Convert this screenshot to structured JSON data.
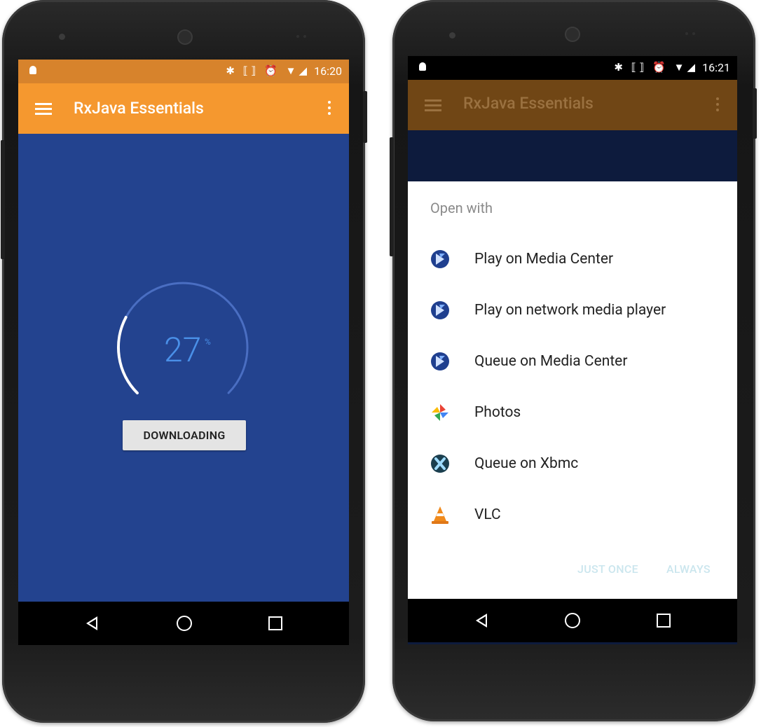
{
  "left_phone": {
    "status_time": "16:20",
    "status_icons": "✱ ⟦⟧ ⏰ ▼◢",
    "app_title": "RxJava Essentials",
    "progress_value": "27",
    "progress_unit": "%",
    "progress_fraction": 0.27,
    "download_button": "DOWNLOADING",
    "colors": {
      "status": "#d7832c",
      "appbar": "#f5982f",
      "content": "#23438f",
      "arc": "#ffffff",
      "track": "#4a6ec2",
      "number": "#4a90e8"
    }
  },
  "right_phone": {
    "status_time": "16:21",
    "status_icons": "✱ ⟦⟧ ⏰ ▼◢",
    "app_title": "RxJava Essentials",
    "dialog": {
      "title": "Open with",
      "options": [
        {
          "label": "Play on Media Center",
          "icon": "kodi-icon"
        },
        {
          "label": "Play on network media player",
          "icon": "kodi-icon"
        },
        {
          "label": "Queue on Media Center",
          "icon": "kodi-icon"
        },
        {
          "label": "Photos",
          "icon": "pinwheel-icon"
        },
        {
          "label": "Queue on Xbmc",
          "icon": "xbmc-icon"
        },
        {
          "label": "VLC",
          "icon": "vlc-cone-icon"
        }
      ],
      "just_once": "JUST ONCE",
      "always": "ALWAYS"
    },
    "colors": {
      "status": "#000000",
      "appbar": "#704615",
      "scrim": "#0d1b3d",
      "dialog": "#ffffff",
      "button_text": "#cbe6ee"
    }
  },
  "nav_icons": [
    "back-icon",
    "home-icon",
    "recents-icon"
  ]
}
